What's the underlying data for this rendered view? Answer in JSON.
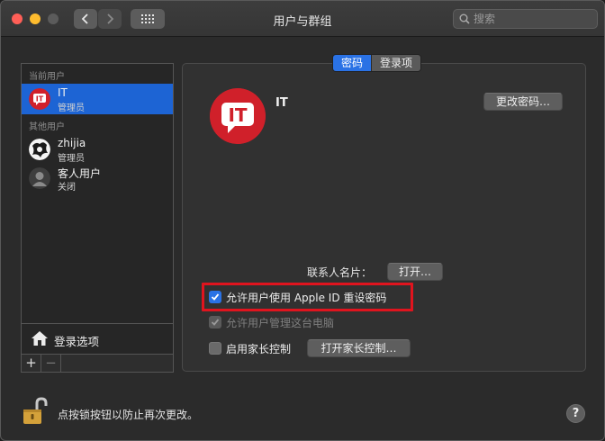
{
  "window": {
    "title": "用户与群组",
    "search_placeholder": "搜索"
  },
  "sidebar": {
    "current_section": "当前用户",
    "other_section": "其他用户",
    "current_user": {
      "name": "IT",
      "role": "管理员",
      "avatar_icon": "it-logo-icon"
    },
    "other_users": [
      {
        "name": "zhijia",
        "role": "管理员",
        "avatar_icon": "zhijia-avatar-icon"
      },
      {
        "name": "客人用户",
        "role": "关闭",
        "avatar_icon": "guest-user-icon"
      }
    ],
    "login_options_label": "登录选项",
    "add_label": "+",
    "remove_label": "−"
  },
  "panel": {
    "tabs": [
      {
        "label": "密码",
        "active": true
      },
      {
        "label": "登录项",
        "active": false
      }
    ],
    "user_name": "IT",
    "change_password_label": "更改密码…",
    "contact_card_label": "联系人名片：",
    "open_card_label": "打开…",
    "options": [
      {
        "label": "允许用户使用 Apple ID 重设密码",
        "checked": true,
        "enabled": true
      },
      {
        "label": "允许用户管理这台电脑",
        "checked": true,
        "enabled": false
      },
      {
        "label": "启用家长控制",
        "checked": false,
        "enabled": true
      }
    ],
    "open_parental_label": "打开家长控制…"
  },
  "footer": {
    "lock_text": "点按锁按钮以防止再次更改。",
    "help_label": "?"
  },
  "colors": {
    "accent": "#2a72e5",
    "selection": "#1d64d4",
    "brand_red": "#d0202a",
    "highlight_box": "#e0141e"
  }
}
